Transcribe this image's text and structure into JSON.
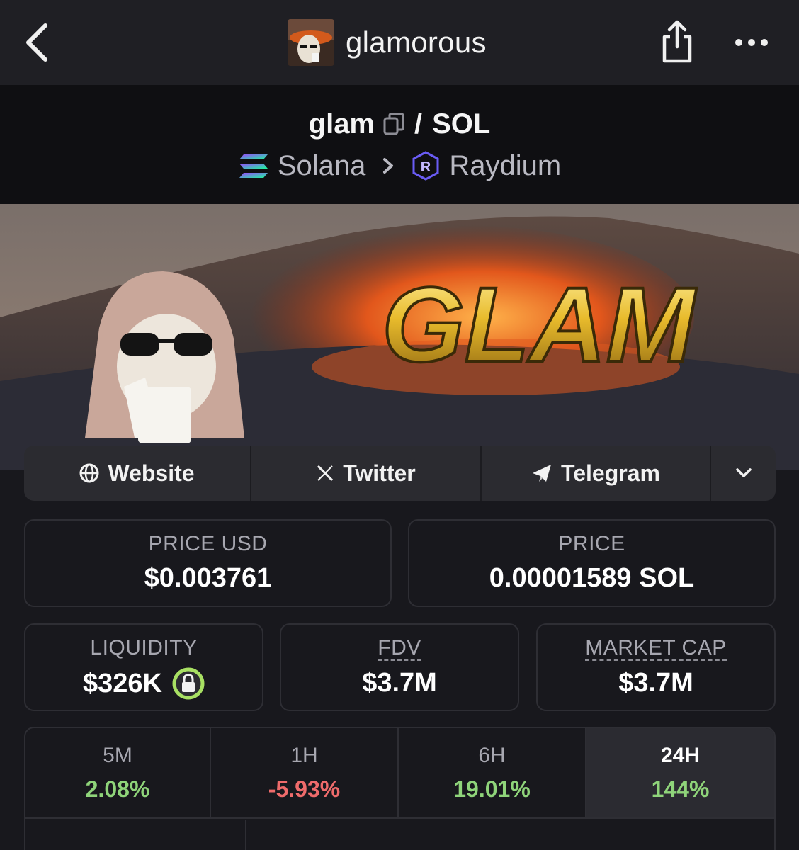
{
  "nav": {
    "title": "glamorous"
  },
  "pair": {
    "base": "glam",
    "separator": "/",
    "quote": "SOL",
    "chain": "Solana",
    "dex": "Raydium"
  },
  "banner": {
    "logo_text": "GLAM"
  },
  "links": [
    {
      "label": "Website",
      "icon": "globe-icon"
    },
    {
      "label": "Twitter",
      "icon": "x-logo-icon"
    },
    {
      "label": "Telegram",
      "icon": "telegram-icon"
    }
  ],
  "stats": {
    "price_usd_label": "PRICE USD",
    "price_usd": "$0.003761",
    "price_label": "PRICE",
    "price": "0.00001589 SOL",
    "liquidity_label": "LIQUIDITY",
    "liquidity": "$326K",
    "fdv_label": "FDV",
    "fdv": "$3.7M",
    "mcap_label": "MARKET CAP",
    "mcap": "$3.7M"
  },
  "timeframes": [
    {
      "label": "5M",
      "change": "2.08%",
      "color": "#8fd47a"
    },
    {
      "label": "1H",
      "change": "-5.93%",
      "color": "#ef6b6b"
    },
    {
      "label": "6H",
      "change": "19.01%",
      "color": "#8fd47a"
    },
    {
      "label": "24H",
      "change": "144%",
      "color": "#8fd47a"
    }
  ],
  "colors": {
    "background": "#18181d",
    "positive": "#8fd47a",
    "negative": "#ef6b6b",
    "lock_ring": "#a8e063"
  }
}
